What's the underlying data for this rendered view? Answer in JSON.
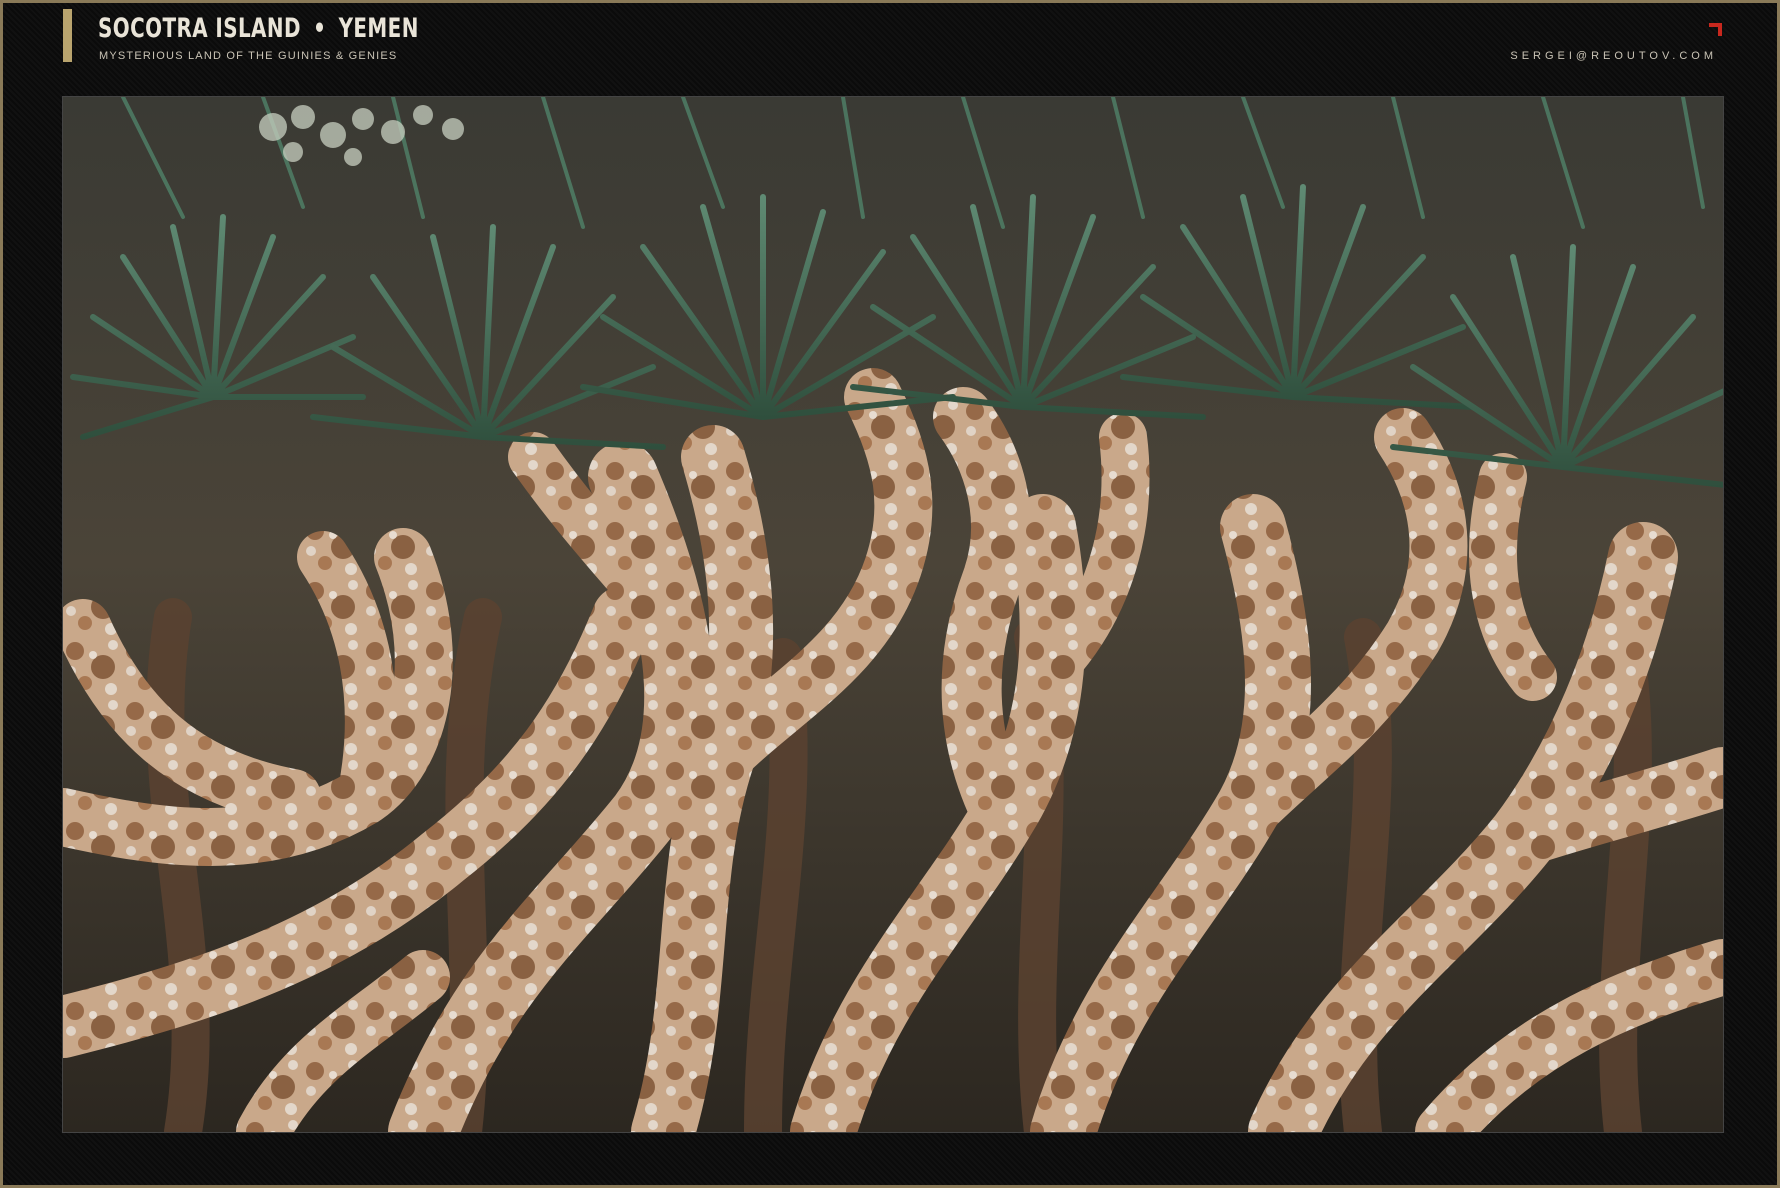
{
  "header": {
    "title_left": "SOCOTRA ISLAND",
    "title_sep": "•",
    "title_right": "YEMEN",
    "subtitle": "MYSTERIOUS LAND OF THE GUINIES & GENIES",
    "email": "SERGEI@REOUTOV.COM"
  },
  "colors": {
    "frame_border": "#8a7a58",
    "accent": "#b9a46e",
    "corner_mark": "#c8281e",
    "background": "#0d0d0d"
  },
  "photo": {
    "subject": "dragon-blood-tree-canopy"
  }
}
